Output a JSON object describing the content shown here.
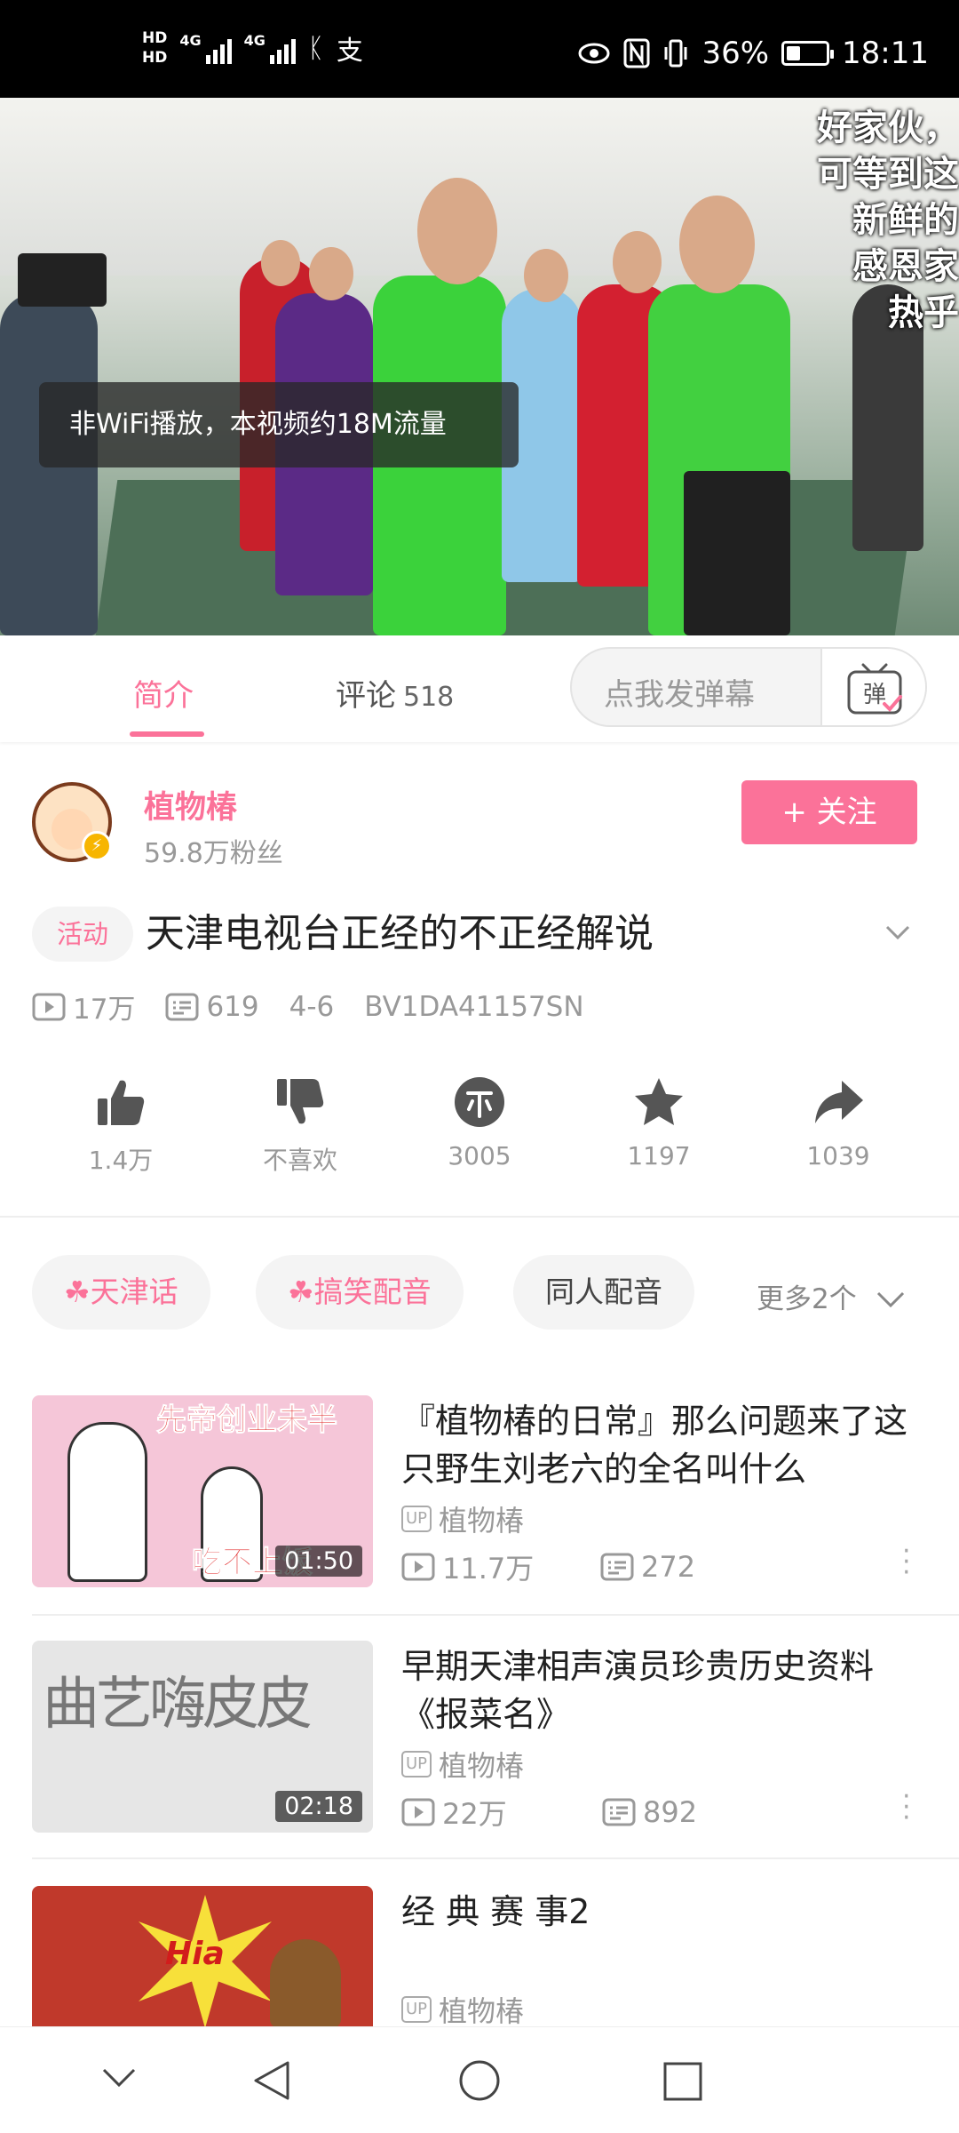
{
  "status_bar": {
    "time": "18:11",
    "battery_percent": "36%",
    "battery_level": 0.36,
    "hd1": "HD",
    "hd2": "HD",
    "net1": "4G",
    "net2": "4G"
  },
  "video": {
    "toast": "非WiFi播放，本视频约18M流量",
    "danmaku": [
      "好家伙，",
      "可等到这",
      "新鲜的",
      "感恩家",
      "热乎"
    ]
  },
  "tabs": {
    "intro": "简介",
    "comments": "评论",
    "comment_count": "518",
    "danmaku_placeholder": "点我发弹幕",
    "danmaku_button": "弹"
  },
  "uploader": {
    "name": "植物椿",
    "fans": "59.8万粉丝",
    "follow_label": "+ 关注"
  },
  "video_info": {
    "tag": "活动",
    "title": "天津电视台正经的不正经解说",
    "views": "17万",
    "danmaku_count": "619",
    "date": "4-6",
    "bvid": "BV1DA41157SN"
  },
  "actions": {
    "like": "1.4万",
    "dislike": "不喜欢",
    "coin": "3005",
    "favorite": "1197",
    "share": "1039"
  },
  "tags": {
    "items": [
      "天津话",
      "搞笑配音",
      "同人配音"
    ],
    "more": "更多2个"
  },
  "related": [
    {
      "title": "『植物椿的日常』那么问题来了这只野生刘老六的全名叫什么",
      "up": "植物椿",
      "views": "11.7万",
      "danmaku": "272",
      "duration": "01:50",
      "thumb_caption_top": "先帝创业未半",
      "thumb_caption_bottom": "吃不上饭"
    },
    {
      "title": "早期天津相声演员珍贵历史资料《报菜名》",
      "up": "植物椿",
      "views": "22万",
      "danmaku": "892",
      "duration": "02:18",
      "thumb_caption_top": "曲艺嗨皮皮"
    },
    {
      "title": "经 典 赛 事2",
      "up": "植物椿",
      "thumb_caption_top": "Hia"
    }
  ],
  "colors": {
    "accent": "#fb7299",
    "text": "#212121",
    "muted": "#999999"
  },
  "icons": {
    "nav": [
      "chevron-down-icon",
      "back-icon",
      "home-icon",
      "recents-icon"
    ]
  }
}
